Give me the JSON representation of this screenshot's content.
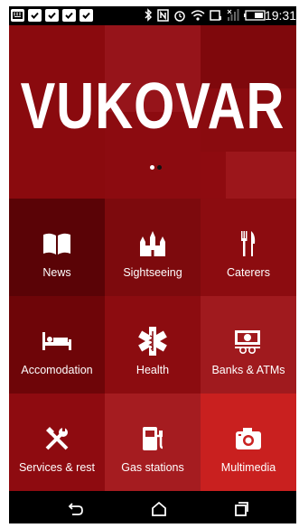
{
  "status_bar": {
    "time": "19:31",
    "notification_icons": [
      "keyboard-icon",
      "clipboard-check-icon",
      "clipboard-check-icon",
      "bag-check-icon",
      "clipboard-check-icon"
    ],
    "system_icons": [
      "bluetooth-icon",
      "nfc-icon",
      "alarm-icon",
      "wifi-icon",
      "data-saver-icon",
      "signal-icon",
      "battery-icon"
    ]
  },
  "hero": {
    "title": "VUKOVAR",
    "page_indicator": {
      "count": 2,
      "active": 1
    }
  },
  "menu": {
    "items": [
      {
        "label": "News",
        "icon": "book-icon",
        "color": "#5a0306"
      },
      {
        "label": "Sightseeing",
        "icon": "castle-icon",
        "color": "#7d0a0d"
      },
      {
        "label": "Caterers",
        "icon": "fork-knife-icon",
        "color": "#8c0c10"
      },
      {
        "label": "Accomodation",
        "icon": "bed-icon",
        "color": "#6e0508"
      },
      {
        "label": "Health",
        "icon": "medical-star-icon",
        "color": "#8c0c10"
      },
      {
        "label": "Banks & ATMs",
        "icon": "money-icon",
        "color": "#a01a1e"
      },
      {
        "label": "Services & rest",
        "icon": "tools-icon",
        "color": "#8e0b10"
      },
      {
        "label": "Gas stations",
        "icon": "gas-pump-icon",
        "color": "#a51c20"
      },
      {
        "label": "Multimedia",
        "icon": "camera-icon",
        "color": "#c9201f"
      }
    ]
  },
  "nav_bar": {
    "buttons": [
      "back-icon",
      "home-icon",
      "recents-icon"
    ]
  },
  "colors": {
    "hero_bg": "#8e0b10",
    "accent": "#c9201f"
  }
}
